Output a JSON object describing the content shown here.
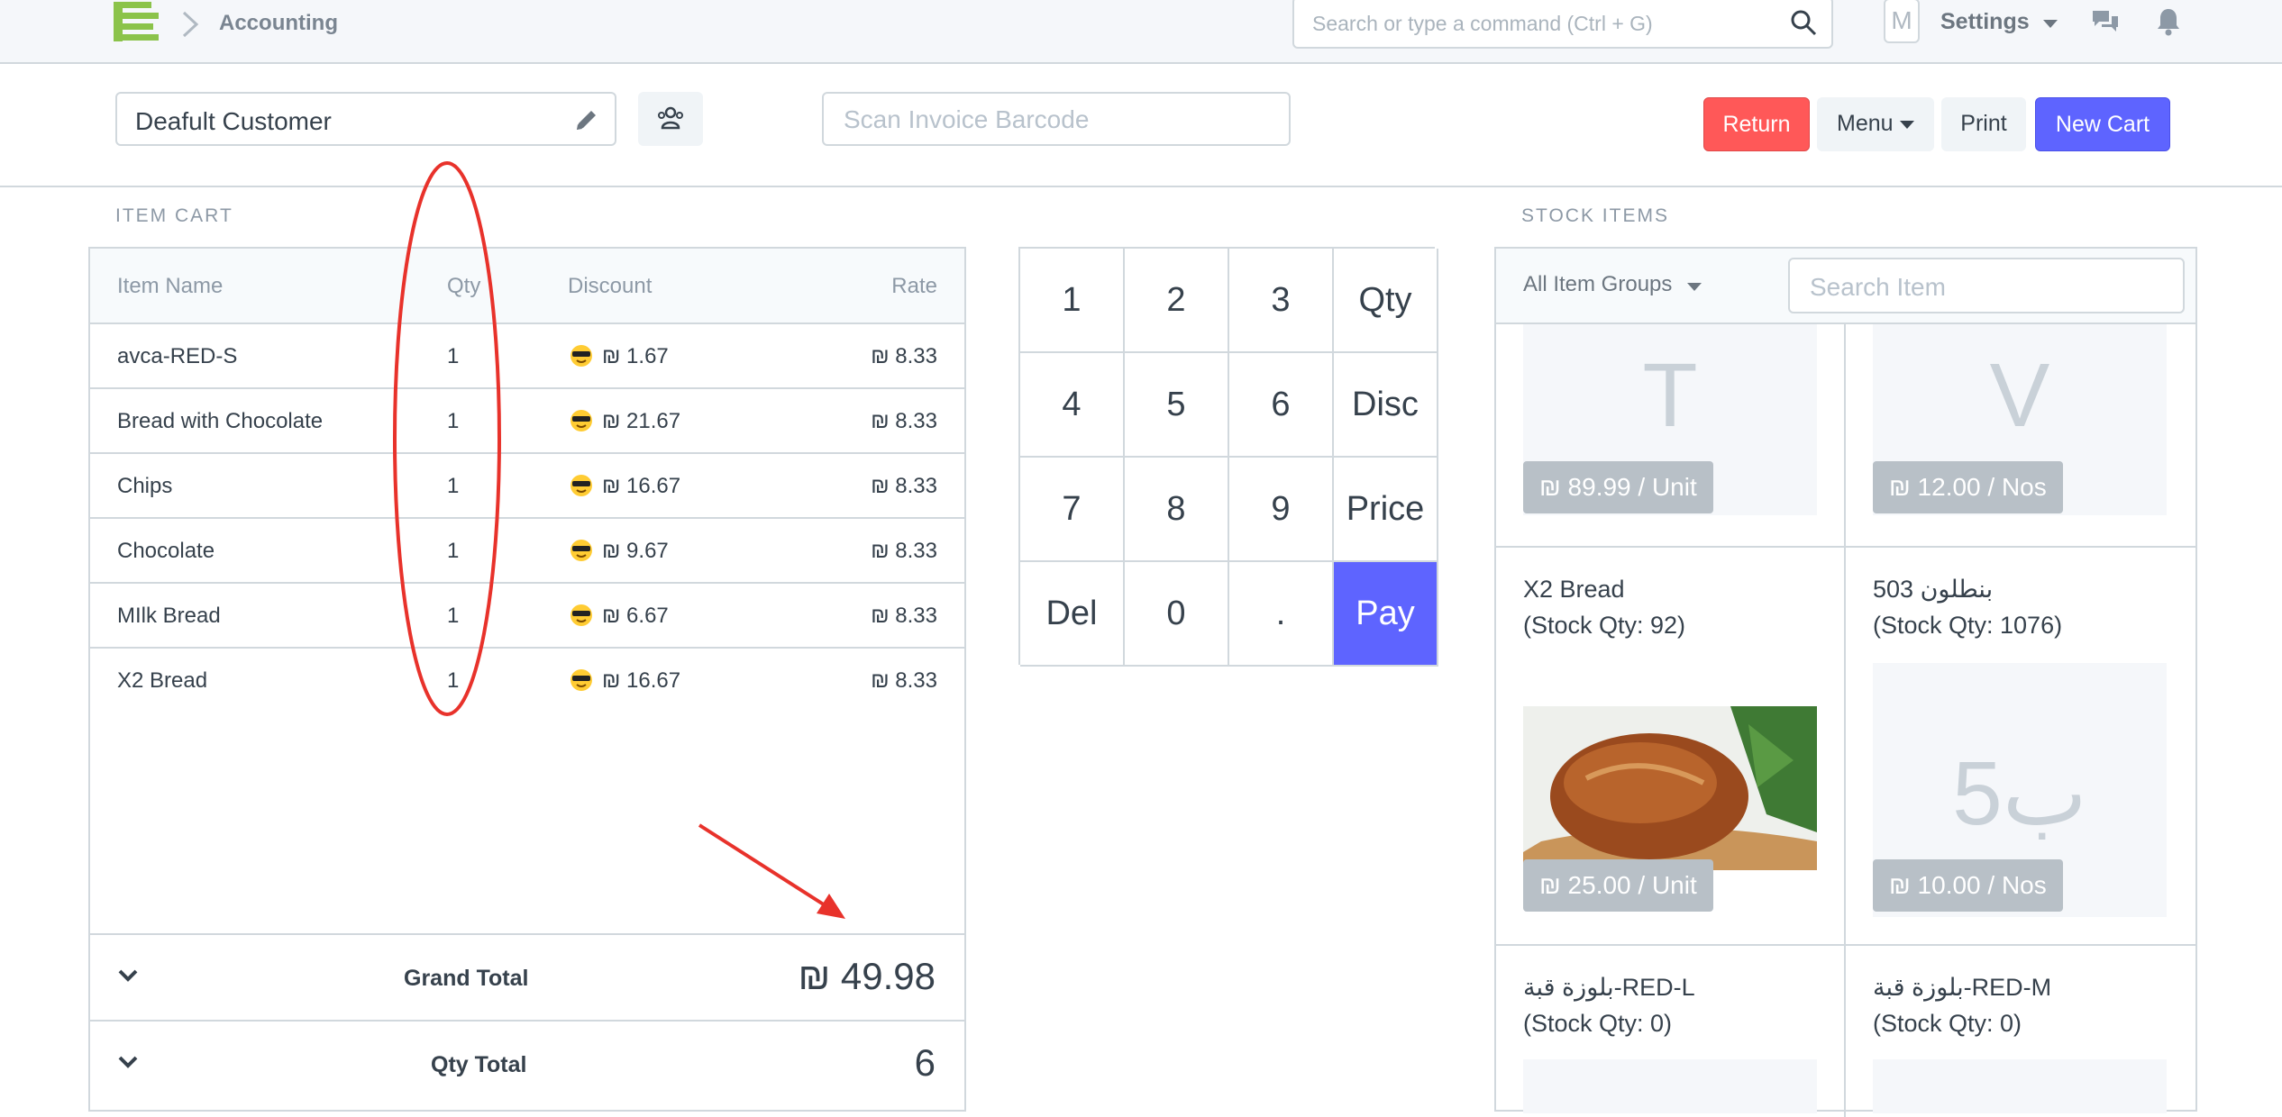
{
  "navbar": {
    "breadcrumb": "Accounting",
    "search_placeholder": "Search or type a command (Ctrl + G)",
    "avatar_initial": "M",
    "settings_label": "Settings"
  },
  "page_head": {
    "customer": "Deafult Customer",
    "barcode_placeholder": "Scan Invoice Barcode",
    "buttons": {
      "return": "Return",
      "menu": "Menu",
      "print": "Print",
      "new_cart": "New Cart"
    }
  },
  "cart": {
    "section_label": "ITEM CART",
    "columns": {
      "name": "Item Name",
      "qty": "Qty",
      "discount": "Discount",
      "rate": "Rate"
    },
    "items": [
      {
        "name": "avca-RED-S",
        "qty": "1",
        "discount": "₪ 1.67",
        "rate": "₪ 8.33"
      },
      {
        "name": "Bread with Chocolate",
        "qty": "1",
        "discount": "₪ 21.67",
        "rate": "₪ 8.33"
      },
      {
        "name": "Chips",
        "qty": "1",
        "discount": "₪ 16.67",
        "rate": "₪ 8.33"
      },
      {
        "name": "Chocolate",
        "qty": "1",
        "discount": "₪ 9.67",
        "rate": "₪ 8.33"
      },
      {
        "name": "MIlk Bread",
        "qty": "1",
        "discount": "₪ 6.67",
        "rate": "₪ 8.33"
      },
      {
        "name": "X2 Bread",
        "qty": "1",
        "discount": "₪ 16.67",
        "rate": "₪ 8.33"
      }
    ],
    "grand_total_label": "Grand Total",
    "grand_total": "₪ 49.98",
    "qty_total_label": "Qty Total",
    "qty_total": "6"
  },
  "numpad": {
    "keys": [
      "1",
      "2",
      "3",
      "Qty",
      "4",
      "5",
      "6",
      "Disc",
      "7",
      "8",
      "9",
      "Price",
      "Del",
      "0",
      ".",
      "Pay"
    ]
  },
  "stock": {
    "section_label": "STOCK ITEMS",
    "group_select": "All Item Groups",
    "search_placeholder": "Search Item",
    "tiles": [
      {
        "letter": "T",
        "price": "₪ 89.99 / Unit"
      },
      {
        "letter": "V",
        "price": "₪ 12.00 / Nos"
      },
      {
        "title": "X2 Bread",
        "stock": "(Stock Qty: 92)",
        "price": "₪ 25.00 / Unit"
      },
      {
        "title": "503 بنطلون",
        "stock": "(Stock Qty: 1076)",
        "letter": "ب5",
        "price": "₪ 10.00 / Nos"
      },
      {
        "title": "بلوزة قبة-RED-L",
        "stock": "(Stock Qty: 0)"
      },
      {
        "title": "بلوزة قبة-RED-M",
        "stock": "(Stock Qty: 0)"
      }
    ]
  },
  "colors": {
    "primary": "#5e64ff",
    "danger": "#ff5858",
    "annotation": "#e8322b"
  }
}
